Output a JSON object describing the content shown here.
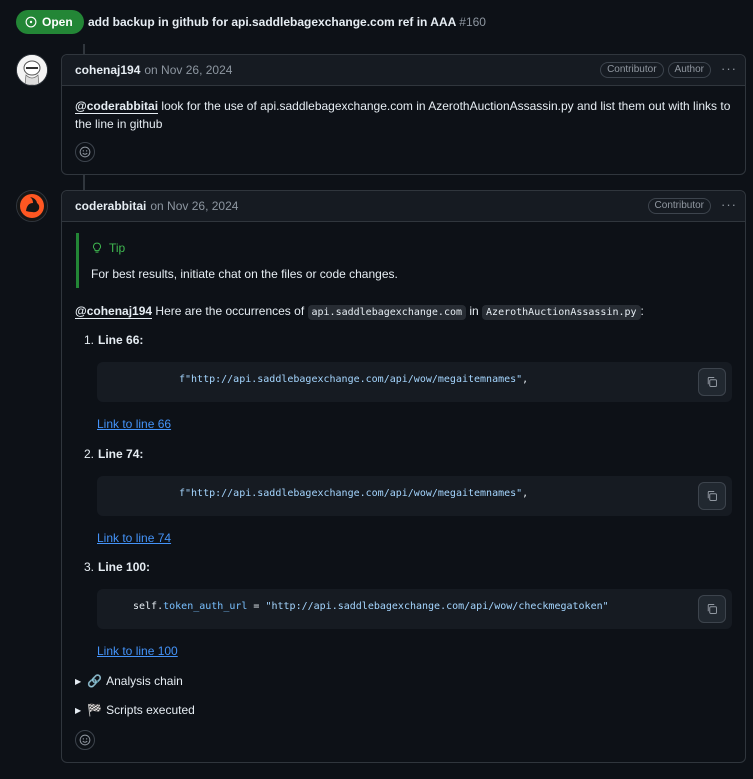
{
  "issue": {
    "state": "Open",
    "title": "add backup in github for api.saddlebagexchange.com ref in AAA",
    "number": "#160"
  },
  "comment1": {
    "author": "cohenaj194",
    "date": "on Nov 26, 2024",
    "badges": [
      "Contributor",
      "Author"
    ],
    "mention": "@coderabbitai",
    "text": " look for the use of api.saddlebagexchange.com in AzerothAuctionAssassin.py and list them out with links to the line in github"
  },
  "comment2": {
    "author": "coderabbitai",
    "date": "on Nov 26, 2024",
    "badges": [
      "Contributor"
    ],
    "tip_title": "Tip",
    "tip_text": "For best results, initiate chat on the files or code changes.",
    "mention": "@cohenaj194",
    "intro_pre": " Here are the occurrences of ",
    "intro_code1": "api.saddlebagexchange.com",
    "intro_mid": " in ",
    "intro_code2": "AzerothAuctionAssassin.py",
    "intro_post": ":",
    "items": [
      {
        "num": "1.",
        "label": "Line 66:",
        "code_str": "f\"http://api.saddlebagexchange.com/api/wow/megaitemnames\"",
        "code_tail": ",",
        "link": "Link to line 66"
      },
      {
        "num": "2.",
        "label": "Line 74:",
        "code_str": "f\"http://api.saddlebagexchange.com/api/wow/megaitemnames\"",
        "code_tail": ",",
        "link": "Link to line 74"
      },
      {
        "num": "3.",
        "label": "Line 100:",
        "code_pre": "self.",
        "code_attr": "token_auth_url",
        "code_op": " = ",
        "code_str": "\"http://api.saddlebagexchange.com/api/wow/checkmegatoken\"",
        "link": "Link to line 100"
      }
    ],
    "details": [
      {
        "icon": "🔗",
        "label": "Analysis chain"
      },
      {
        "icon": "🏁",
        "label": "Scripts executed"
      }
    ]
  },
  "colors": {
    "open_badge": "#238636",
    "link": "#4493f8",
    "tip_accent": "#3fb950",
    "background": "#0d1117"
  }
}
